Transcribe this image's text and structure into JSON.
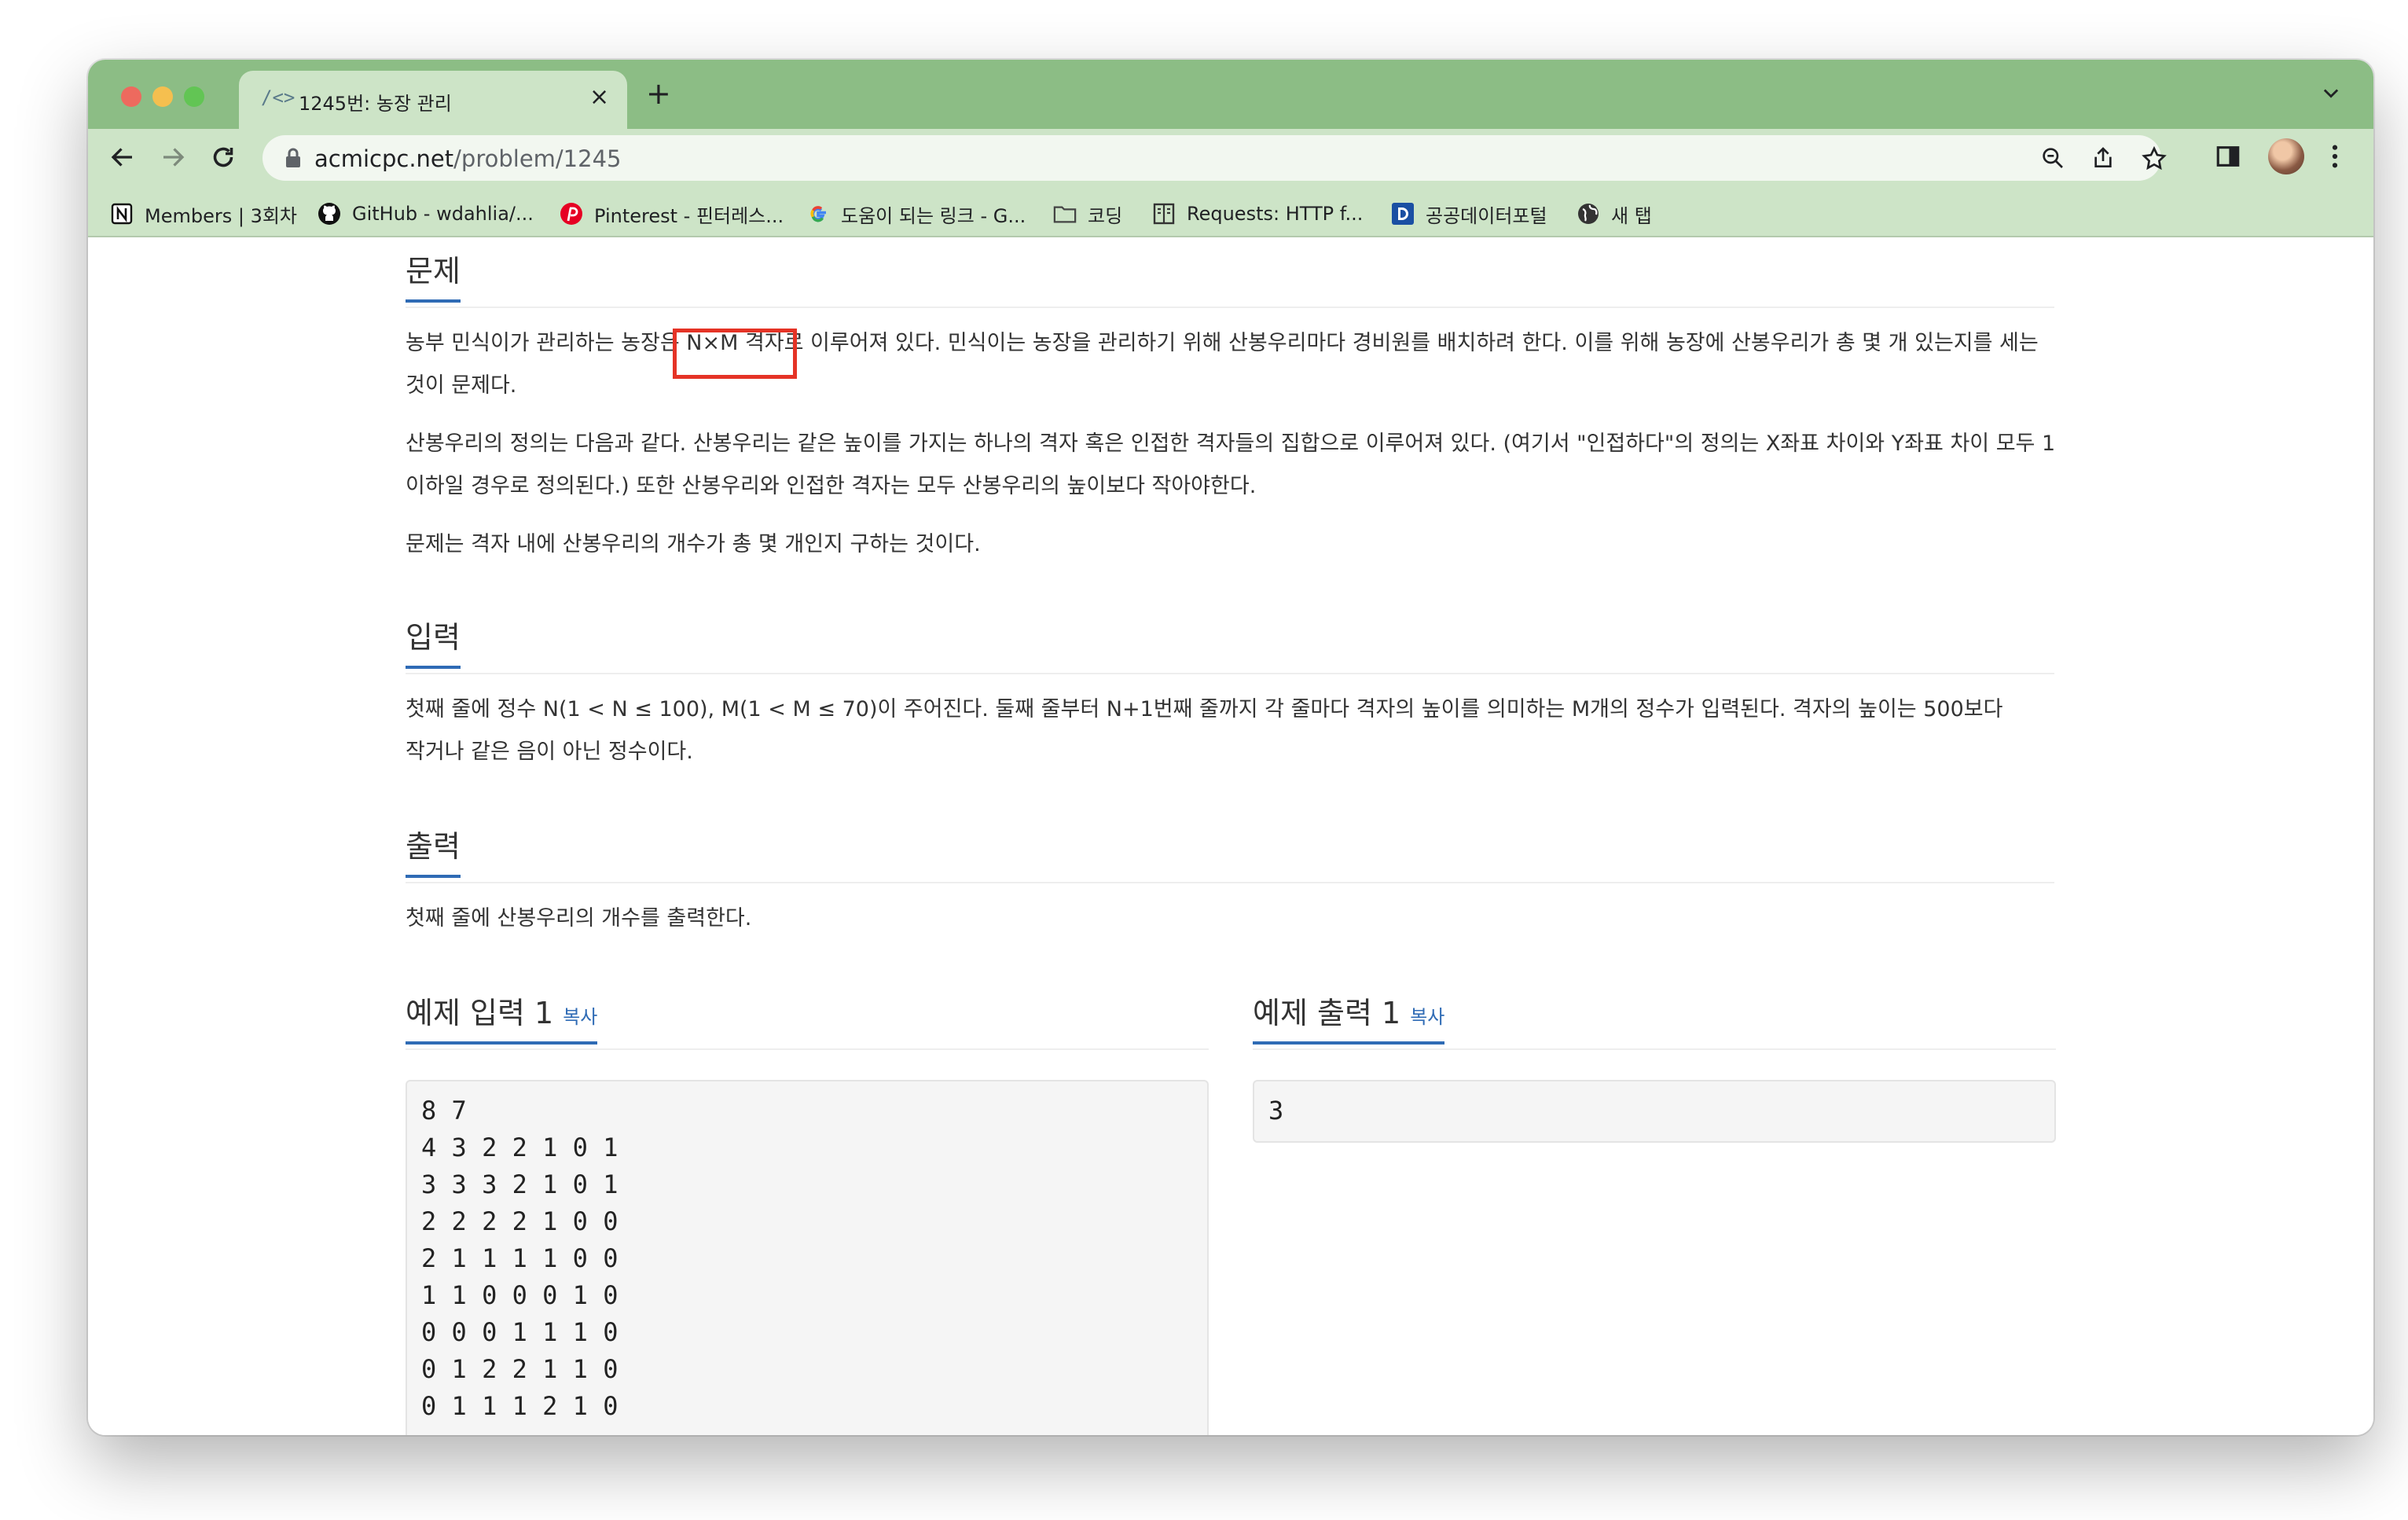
{
  "browser": {
    "tab_title": "1245번: 농장 관리",
    "url_host": "acmicpc.net",
    "url_path": "/problem/1245",
    "bookmarks": [
      {
        "label": "Members | 3회차",
        "icon": "notion-icon"
      },
      {
        "label": "GitHub - wdahlia/...",
        "icon": "github-icon"
      },
      {
        "label": "Pinterest - 핀터레스...",
        "icon": "pinterest-icon"
      },
      {
        "label": "도움이 되는 링크 - G...",
        "icon": "google-icon"
      },
      {
        "label": "코딩",
        "icon": "folder-icon"
      },
      {
        "label": "Requests: HTTP f...",
        "icon": "book-icon"
      },
      {
        "label": "공공데이터포털",
        "icon": "data-portal-icon"
      },
      {
        "label": "새 탭",
        "icon": "globe-icon"
      }
    ]
  },
  "problem": {
    "section_titles": {
      "problem": "문제",
      "input": "입력",
      "output": "출력",
      "sample_input": "예제 입력 1",
      "sample_output": "예제 출력 1"
    },
    "copy_label": "복사",
    "description": [
      "농부 민식이가 관리하는 농장은 N×M 격자로 이루어져 있다. 민식이는 농장을 관리하기 위해 산봉우리마다 경비원를 배치하려 한다. 이를 위해 농장에 산봉우리가 총 몇 개 있는지를 세는 것이 문제다.",
      "산봉우리의 정의는 다음과 같다. 산봉우리는 같은 높이를 가지는 하나의 격자 혹은 인접한 격자들의 집합으로 이루어져 있다. (여기서 \"인접하다\"의 정의는 X좌표 차이와 Y좌표 차이 모두 1 이하일 경우로 정의된다.) 또한 산봉우리와 인접한 격자는 모두 산봉우리의 높이보다 작아야한다.",
      "문제는 격자 내에 산봉우리의 개수가 총 몇 개인지 구하는 것이다."
    ],
    "input_text": "첫째 줄에 정수 N(1 < N ≤ 100), M(1 < M ≤ 70)이 주어진다. 둘째 줄부터 N+1번째 줄까지 각 줄마다 격자의 높이를 의미하는 M개의 정수가 입력된다. 격자의 높이는 500보다 작거나 같은 음이 아닌 정수이다.",
    "output_text": "첫째 줄에 산봉우리의 개수를 출력한다.",
    "sample_input": "8 7\n4 3 2 2 1 0 1\n3 3 3 2 1 0 1\n2 2 2 2 1 0 0\n2 1 1 1 1 0 0\n1 1 0 0 0 1 0\n0 0 0 1 1 1 0\n0 1 2 2 1 1 0\n0 1 1 1 2 1 0",
    "sample_output": "3"
  }
}
